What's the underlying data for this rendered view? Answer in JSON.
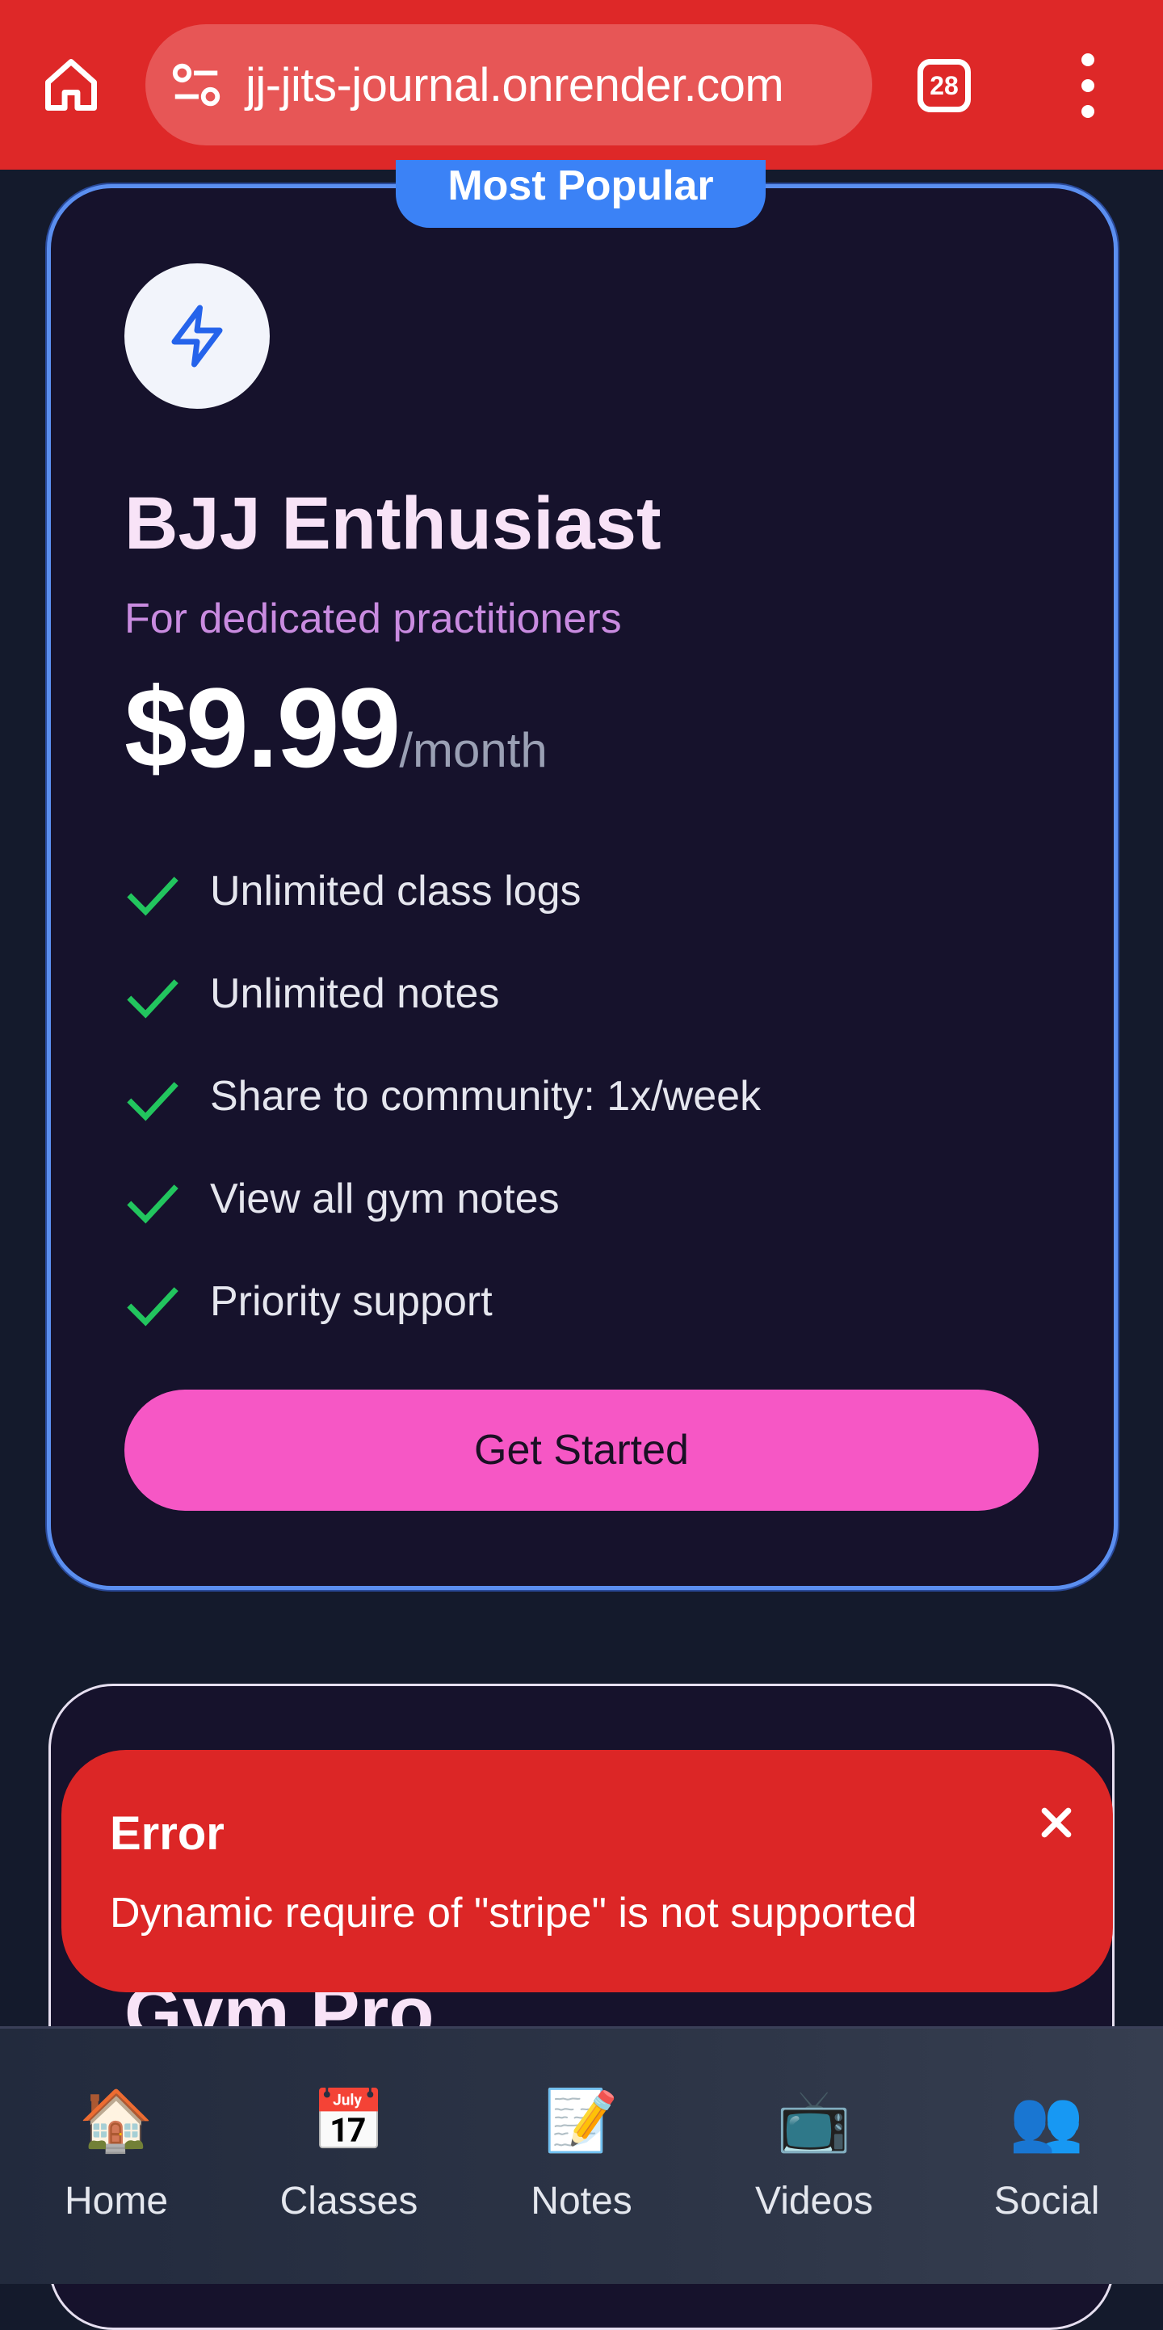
{
  "browser": {
    "url": "jj-jits-journal.onrender.com",
    "tab_count": "28"
  },
  "plan": {
    "badge": "Most Popular",
    "name": "BJJ Enthusiast",
    "tagline": "For dedicated practitioners",
    "price": "$9.99",
    "period": "/month",
    "features": [
      "Unlimited class logs",
      "Unlimited notes",
      "Share to community: 1x/week",
      "View all gym notes",
      "Priority support"
    ],
    "cta_label": "Get Started"
  },
  "plan2": {
    "name": "Gym Pro"
  },
  "toast": {
    "title": "Error",
    "message": "Dynamic require of \"stripe\" is not supported"
  },
  "nav": {
    "items": [
      {
        "label": "Home",
        "icon": "🏠"
      },
      {
        "label": "Classes",
        "icon": "📅"
      },
      {
        "label": "Notes",
        "icon": "📝"
      },
      {
        "label": "Videos",
        "icon": "📺"
      },
      {
        "label": "Social",
        "icon": "👥"
      }
    ]
  },
  "colors": {
    "browser_bar": "#de2828",
    "card_bg": "#16122c",
    "card_border": "#5b8ff0",
    "badge": "#3b82f6",
    "cta": "#f657c5",
    "check": "#22c55e",
    "toast": "#dc2626"
  }
}
